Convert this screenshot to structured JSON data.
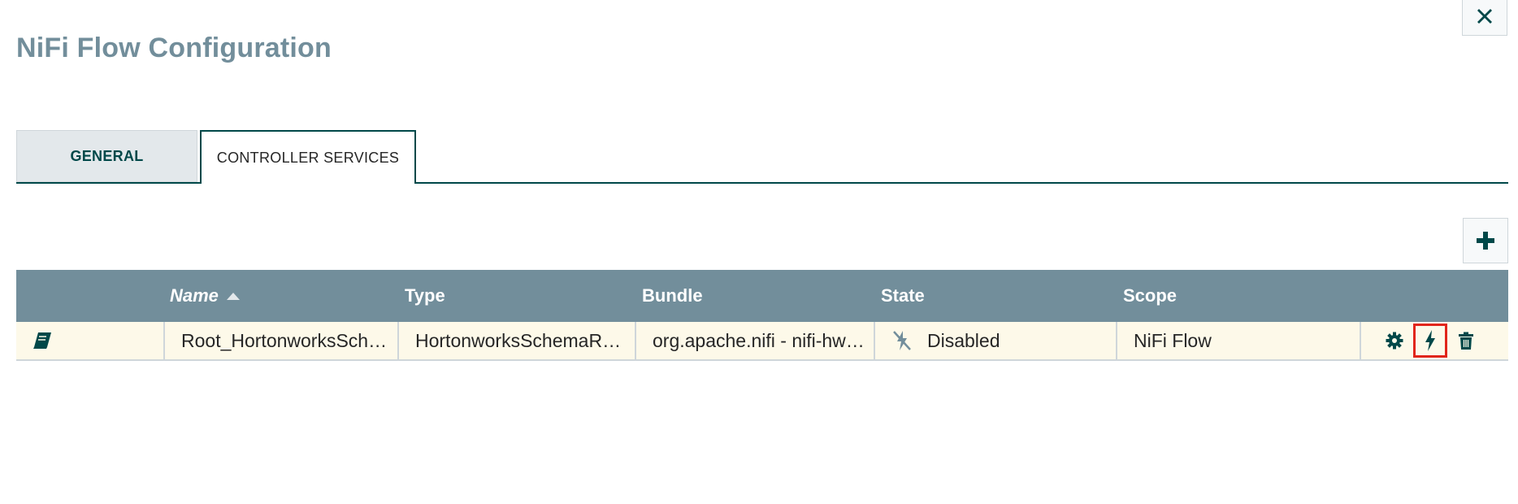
{
  "window": {
    "title": "NiFi Flow Configuration",
    "close_icon": "close-icon"
  },
  "tabs": [
    {
      "label": "GENERAL",
      "active": false
    },
    {
      "label": "CONTROLLER SERVICES",
      "active": true
    }
  ],
  "toolbar": {
    "add_icon": "plus-icon"
  },
  "table": {
    "columns": [
      "",
      "Name",
      "Type",
      "Bundle",
      "State",
      "Scope",
      ""
    ],
    "sort": {
      "column": "Name",
      "direction": "ascending"
    },
    "rows": [
      {
        "icon": "book-icon",
        "name": "Root_HortonworksSch…",
        "type": "HortonworksSchemaR…",
        "bundle": "org.apache.nifi - nifi-hw…",
        "state": "Disabled",
        "state_icon": "disabled-icon",
        "scope": "NiFi Flow",
        "actions": [
          "gear-icon",
          "bolt-icon",
          "trash-icon"
        ]
      }
    ]
  },
  "colors": {
    "accent": "#004849",
    "header_bg": "#728e9b",
    "row_bg": "#fdf9e9",
    "highlight": "#e1251b"
  }
}
